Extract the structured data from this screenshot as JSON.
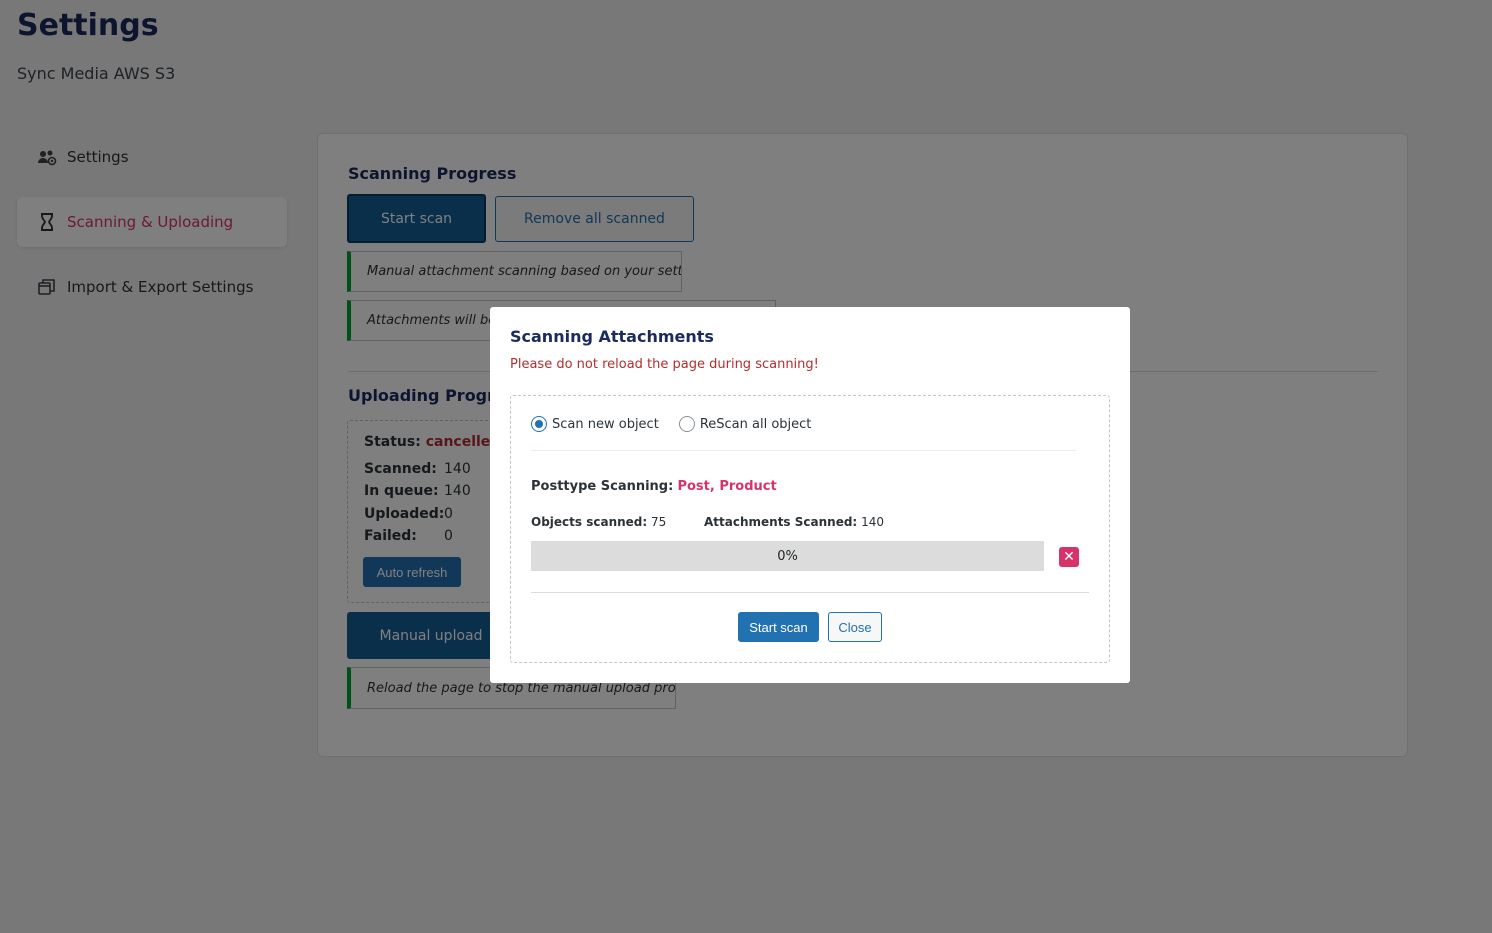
{
  "page": {
    "title": "Settings",
    "subtitle": "Sync Media AWS S3"
  },
  "sidebar": {
    "items": [
      {
        "label": "Settings",
        "icon": "users-gear-icon",
        "active": false
      },
      {
        "label": "Scanning & Uploading",
        "icon": "hourglass-icon",
        "active": true
      },
      {
        "label": "Import & Export Settings",
        "icon": "copy-windows-icon",
        "active": false
      }
    ]
  },
  "scanning": {
    "title": "Scanning Progress",
    "start_scan_label": "Start scan",
    "remove_all_label": "Remove all scanned",
    "notice1": "Manual attachment scanning based on your settings!",
    "notice2": "Attachments will be u"
  },
  "uploading": {
    "title": "Uploading Progre",
    "status_label": "Status:",
    "status_value": "cancelled",
    "scanned_label": "Scanned:",
    "scanned_value": "140",
    "in_queue_label": "In queue:",
    "in_queue_value": "140",
    "uploaded_label": "Uploaded:",
    "uploaded_value": "0",
    "failed_label": "Failed:",
    "failed_value": "0",
    "auto_refresh_label": "Auto refresh",
    "manual_upload_label": "Manual upload",
    "notice": "Reload the page to stop the manual upload process!"
  },
  "modal": {
    "title": "Scanning Attachments",
    "warning": "Please do not reload the page during scanning!",
    "radio_new": "Scan new object",
    "radio_rescan": "ReScan all object",
    "selected_option": "Scan new object",
    "posttype_label": "Posttype Scanning:",
    "posttype_value": "Post, Product",
    "objects_scanned_label": "Objects scanned:",
    "objects_scanned_value": "75",
    "attachments_scanned_label": "Attachments Scanned:",
    "attachments_scanned_value": "140",
    "progress_percent": 0,
    "progress_text": "0%",
    "cancel_icon": "close-x-icon",
    "start_scan_label": "Start scan",
    "close_label": "Close"
  },
  "colors": {
    "accent": "#2271b1",
    "active_pink": "#d6336c",
    "status_red": "#b32d2e",
    "title_navy": "#1a2b5c"
  }
}
